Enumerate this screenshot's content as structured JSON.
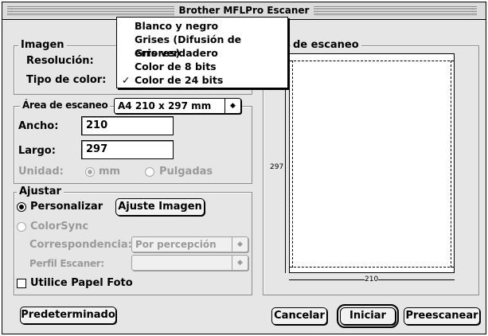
{
  "window": {
    "title": "Brother MFLPro Escaner"
  },
  "color_menu": {
    "items": [
      {
        "label": "Blanco y negro",
        "checked": false
      },
      {
        "label": "Grises (Difusión de errores)",
        "checked": false
      },
      {
        "label": "Gris verdadero",
        "checked": false
      },
      {
        "label": "Color de 8 bits",
        "checked": false
      },
      {
        "label": "Color de 24 bits",
        "checked": true
      }
    ],
    "check_glyph": "✓"
  },
  "imagen": {
    "group_label": "Imagen",
    "resolution_label": "Resolución:",
    "color_type_label": "Tipo de color:"
  },
  "scan_area": {
    "label": "Área de escaneo",
    "size_value": "A4 210 x 297 mm",
    "width_label": "Ancho:",
    "width_value": "210",
    "height_label": "Largo:",
    "height_value": "297",
    "unit_label": "Unidad:",
    "unit_mm": "mm",
    "unit_inches": "Pulgadas",
    "unit_selected": "mm"
  },
  "ajustar": {
    "group_label": "Ajustar",
    "personalizar_label": "Personalizar",
    "ajuste_button": "Ajuste Imagen",
    "colorsync_label": "ColorSync",
    "correspondencia_label": "Correspondencia:",
    "correspondencia_value": "Por percepción",
    "perfil_label": "Perfil Escaner:",
    "perfil_value": "",
    "papel_foto_label": "Utilice Papel Foto",
    "papel_foto_checked": false
  },
  "preview": {
    "group_label": "de escaneo",
    "height_marker": "297",
    "width_marker": "210"
  },
  "buttons": {
    "default_label": "Predeterminado",
    "cancel_label": "Cancelar",
    "start_label": "Iniciar",
    "prescan_label": "Preescanear"
  },
  "icons": {
    "popup_arrow": "◆",
    "checked": "checkmark-icon",
    "radio": "radio-button-icon"
  }
}
